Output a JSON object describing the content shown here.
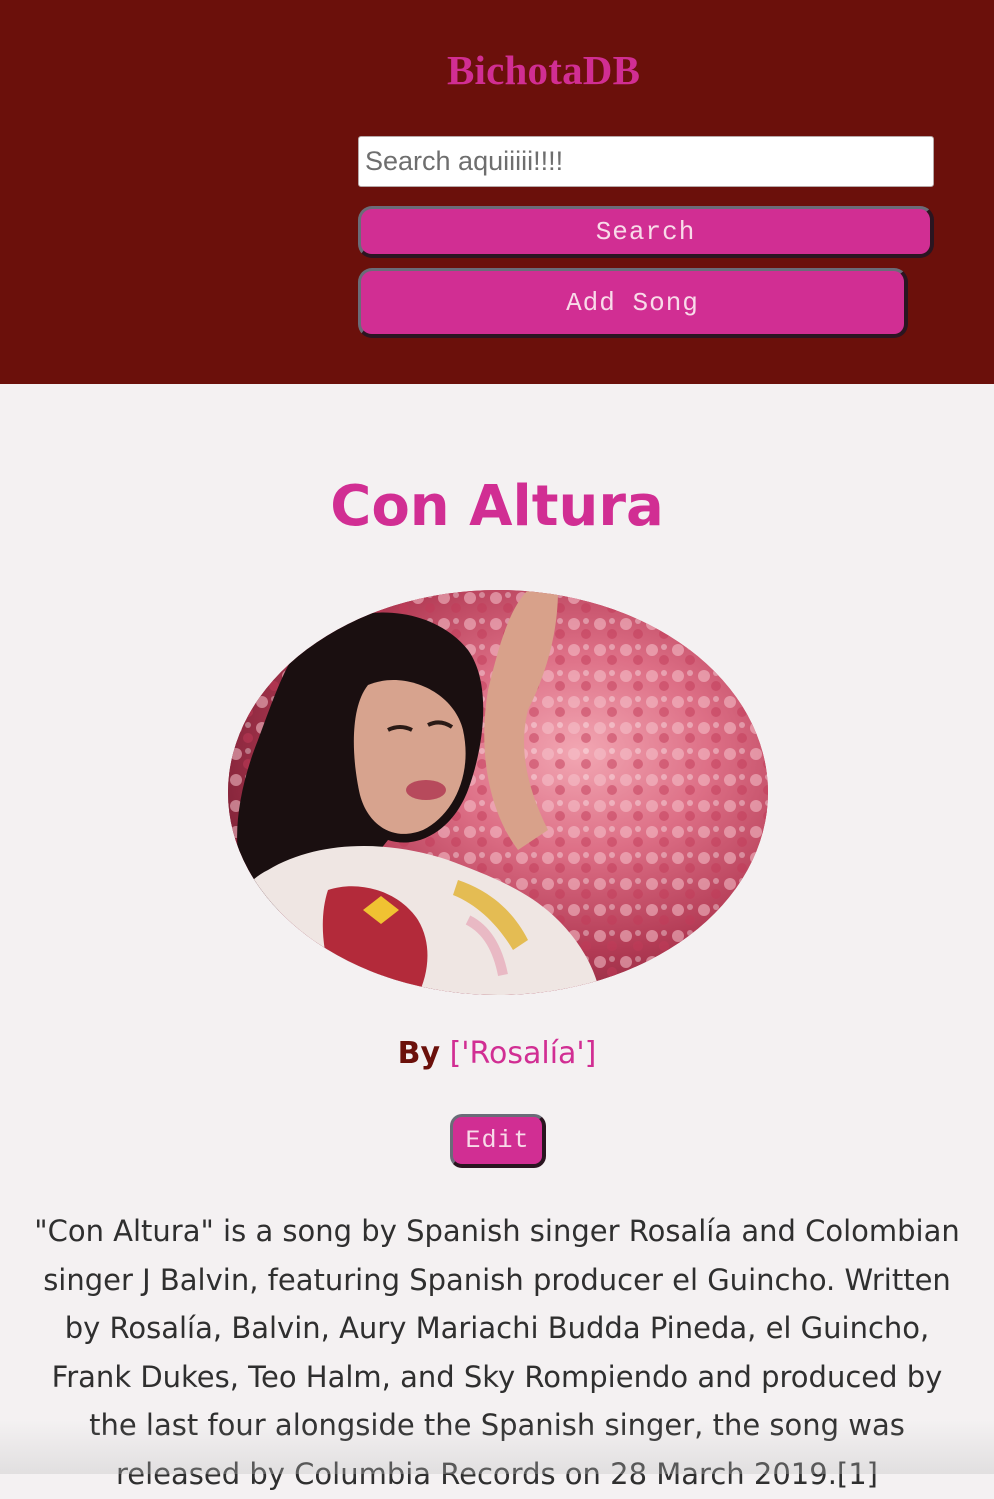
{
  "header": {
    "brand": "BichotaDB",
    "search": {
      "placeholder": "Search aquiiiii!!!!",
      "value": ""
    },
    "search_button": "Search",
    "add_song_button": "Add Song"
  },
  "song": {
    "title": "Con Altura",
    "by_label": "By",
    "artists": "['Rosalía']",
    "edit_button": "Edit",
    "description": "\"Con Altura\" is a song by Spanish singer Rosalía and Colombian singer J Balvin, featuring Spanish producer el Guincho. Written by Rosalía, Balvin, Aury Mariachi Budda Pineda, el Guincho, Frank Dukes, Teo Halm, and Sky Rompiendo and produced by the last four alongside the Spanish singer, the song was released by Columbia Records on 28 March 2019.[1]"
  },
  "colors": {
    "header_bg": "#6b100b",
    "accent": "#d12e93",
    "page_bg": "#f4f1f2"
  }
}
